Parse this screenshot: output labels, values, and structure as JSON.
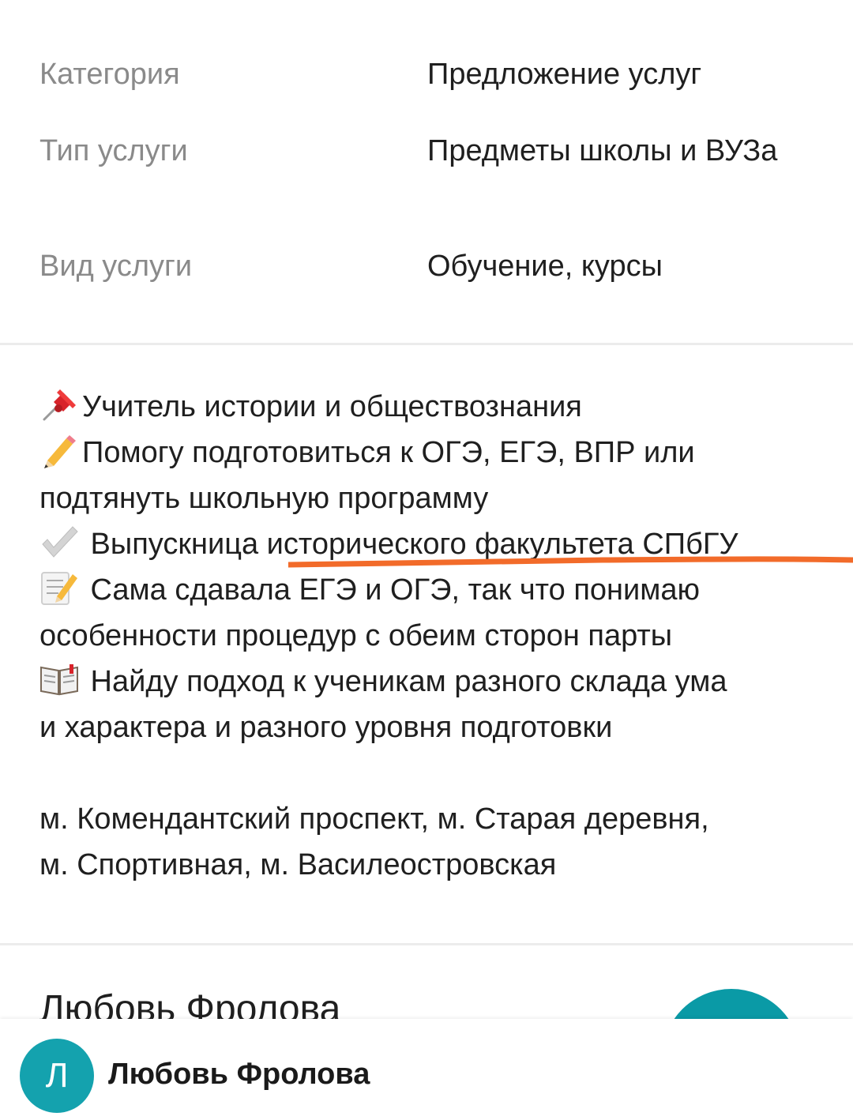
{
  "colors": {
    "label": "#8a8a8a",
    "text": "#1f1f1f",
    "divider": "#ececec",
    "avatar": "#14a2ae",
    "annotation_underline": "#f26b2a"
  },
  "params": [
    {
      "label": "Категория",
      "value": "Предложение услуг"
    },
    {
      "label": "Тип услуги",
      "value": "Предметы школы и ВУЗа"
    },
    {
      "label": "Вид услуги",
      "value": "Обучение, курсы"
    }
  ],
  "description": {
    "line1": "Учитель истории и обществознания",
    "line2": "Помогу подготовиться к ОГЭ, ЕГЭ, ВПР или",
    "line3": "подтянуть школьную программу",
    "line4": " Выпускница исторического факультета СПбГУ",
    "line5": " Сама сдавала ЕГЭ и ОГЭ, так что понимаю",
    "line6": "особенности процедур с обеим сторон парты",
    "line7": " Найду подход к ученикам разного склада ума",
    "line8": "и характера и разного уровня подготовки",
    "icons": [
      "pushpin-icon",
      "pencil-icon",
      "check-mark-icon",
      "memo-icon",
      "open-book-icon"
    ]
  },
  "metro": {
    "line1": "м. Комендантский проспект, м. Старая деревня,",
    "line2": "м. Спортивная, м. Василеостровская"
  },
  "seller": {
    "name": "Любовь Фролова"
  },
  "bottom_bar": {
    "avatar_letter": "Л",
    "name": "Любовь Фролова"
  }
}
